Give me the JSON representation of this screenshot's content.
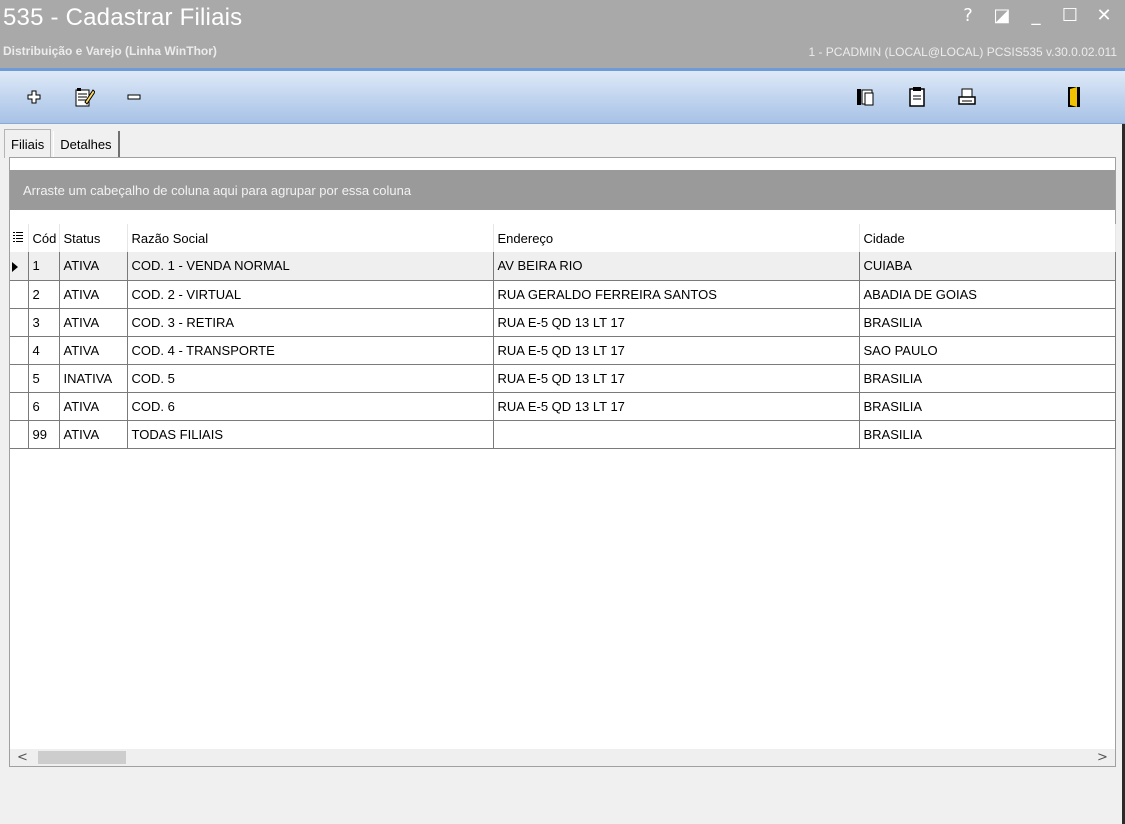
{
  "window": {
    "title": "535 - Cadastrar Filiais",
    "subtitle": "Distribuição e Varejo (Linha WinThor)",
    "session": "1 - PCADMIN (LOCAL@LOCAL)   PCSIS535  v.30.0.02.011",
    "controls": {
      "help": "?",
      "restore": "◪",
      "minimize": "_",
      "maximize": "☐",
      "close": "✕"
    }
  },
  "toolbar": {
    "buttons": [
      {
        "name": "add-icon"
      },
      {
        "name": "edit-icon"
      },
      {
        "name": "remove-icon"
      },
      {
        "name": "copy-icon"
      },
      {
        "name": "report-icon"
      },
      {
        "name": "print-icon"
      },
      {
        "name": "exit-icon"
      }
    ]
  },
  "tabs": [
    {
      "label": "Filiais",
      "active": true
    },
    {
      "label": "Detalhes",
      "active": false
    }
  ],
  "grid": {
    "group_panel_text": "Arraste um cabeçalho de coluna aqui para agrupar por essa coluna",
    "columns": [
      "Cód",
      "Status",
      "Razão Social",
      "Endereço",
      "Cidade"
    ],
    "rows": [
      {
        "cod": "1",
        "status": "ATIVA",
        "razao": "COD. 1 - VENDA NORMAL",
        "endereco": "AV BEIRA RIO",
        "cidade": "CUIABA"
      },
      {
        "cod": "2",
        "status": "ATIVA",
        "razao": "COD. 2 - VIRTUAL",
        "endereco": "RUA GERALDO FERREIRA SANTOS",
        "cidade": "ABADIA DE GOIAS"
      },
      {
        "cod": "3",
        "status": "ATIVA",
        "razao": "COD. 3 - RETIRA",
        "endereco": "RUA E-5 QD 13 LT 17",
        "cidade": "BRASILIA"
      },
      {
        "cod": "4",
        "status": "ATIVA",
        "razao": "COD. 4 - TRANSPORTE",
        "endereco": "RUA E-5 QD 13 LT 17",
        "cidade": "SAO PAULO"
      },
      {
        "cod": "5",
        "status": "INATIVA",
        "razao": "COD. 5",
        "endereco": "RUA E-5 QD 13 LT 17",
        "cidade": "BRASILIA"
      },
      {
        "cod": "6",
        "status": "ATIVA",
        "razao": "COD. 6",
        "endereco": "RUA E-5 QD 13 LT 17",
        "cidade": "BRASILIA"
      },
      {
        "cod": "99",
        "status": "ATIVA",
        "razao": "TODAS FILIAIS",
        "endereco": "",
        "cidade": "BRASILIA"
      }
    ]
  },
  "scrollbar": {
    "left_arrow": "<",
    "right_arrow": ">"
  }
}
